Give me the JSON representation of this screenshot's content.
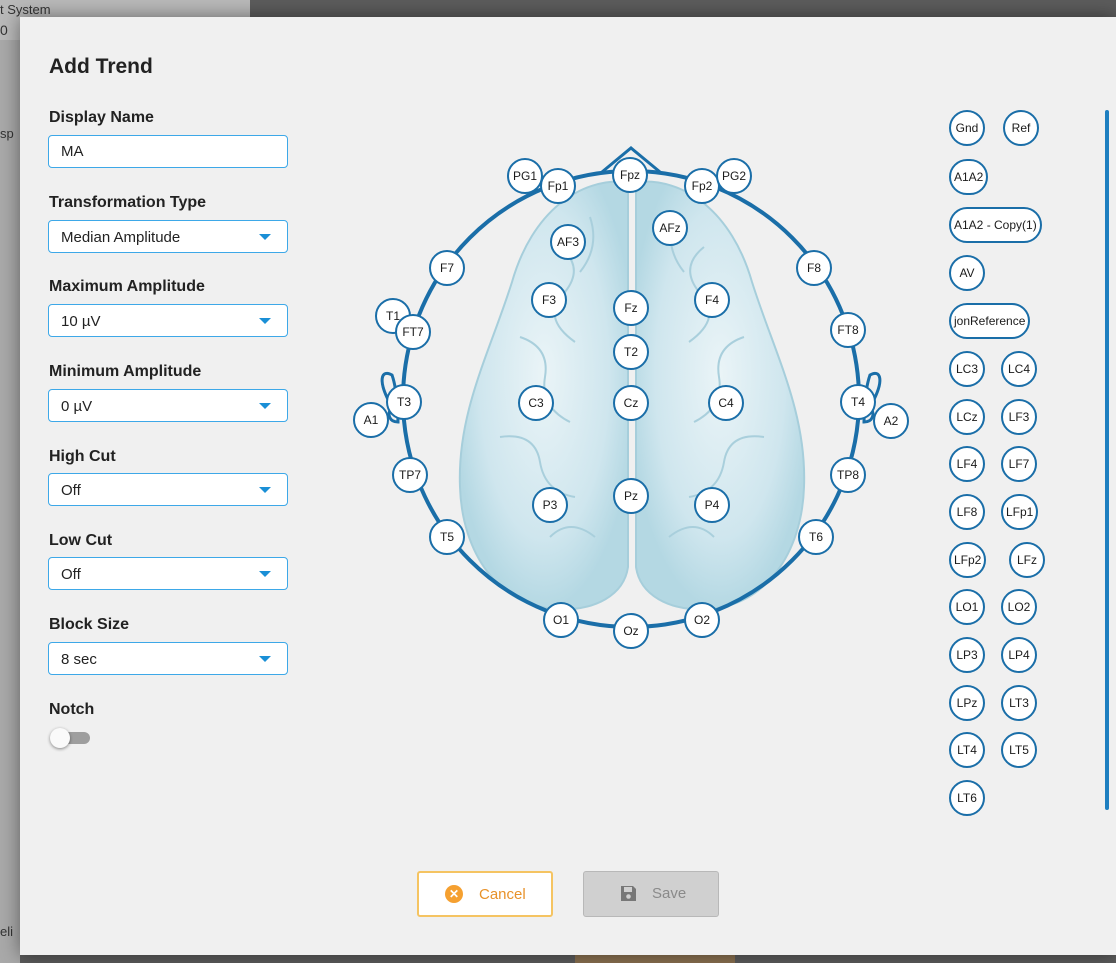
{
  "background": {
    "window_title_fragment": "t System",
    "value_fragment": "0",
    "left_fragment_1": "sp",
    "left_fragment_2": "eli"
  },
  "dialog": {
    "title": "Add Trend",
    "fields": {
      "display_name": {
        "label": "Display Name",
        "value": "MA"
      },
      "transformation_type": {
        "label": "Transformation Type",
        "value": "Median Amplitude"
      },
      "maximum_amplitude": {
        "label": "Maximum Amplitude",
        "value": "10 µV"
      },
      "minimum_amplitude": {
        "label": "Minimum Amplitude",
        "value": "0 µV"
      },
      "high_cut": {
        "label": "High Cut",
        "value": "Off"
      },
      "low_cut": {
        "label": "Low Cut",
        "value": "Off"
      },
      "block_size": {
        "label": "Block Size",
        "value": "8 sec"
      },
      "notch": {
        "label": "Notch",
        "enabled": false
      }
    },
    "electrodes": {
      "PG1": "PG1",
      "Fp1": "Fp1",
      "Fpz": "Fpz",
      "Fp2": "Fp2",
      "PG2": "PG2",
      "AF3": "AF3",
      "AFz": "AFz",
      "F7": "F7",
      "F3": "F3",
      "Fz": "Fz",
      "F4": "F4",
      "F8": "F8",
      "T1": "T1",
      "FT7": "FT7",
      "T2": "T2",
      "FT8": "FT8",
      "A1": "A1",
      "T3": "T3",
      "C3": "C3",
      "Cz": "Cz",
      "C4": "C4",
      "T4": "T4",
      "A2": "A2",
      "TP7": "TP7",
      "TP8": "TP8",
      "P3": "P3",
      "Pz": "Pz",
      "P4": "P4",
      "T5": "T5",
      "T6": "T6",
      "O1": "O1",
      "Oz": "Oz",
      "O2": "O2"
    },
    "reference_list": [
      "Gnd",
      "Ref",
      "A1A2",
      "A1A2 - Copy(1)",
      "AV",
      "jonReference",
      "LC3",
      "LC4",
      "LCz",
      "LF3",
      "LF4",
      "LF7",
      "LF8",
      "LFp1",
      "LFp2",
      "LFz",
      "LO1",
      "LO2",
      "LP3",
      "LP4",
      "LPz",
      "LT3",
      "LT4",
      "LT5",
      "LT6"
    ],
    "buttons": {
      "cancel": "Cancel",
      "save": "Save"
    },
    "colors": {
      "accent": "#1a6ea8",
      "input_border": "#3da8e8",
      "cancel": "#f5a030"
    }
  }
}
